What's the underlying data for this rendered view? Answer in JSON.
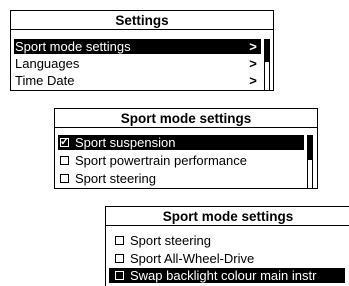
{
  "panel1": {
    "title": "Settings",
    "items": [
      {
        "label": "Sport mode settings",
        "chevron": ">",
        "selected": true
      },
      {
        "label": "Languages",
        "chevron": ">",
        "selected": false
      },
      {
        "label": "Time Date",
        "chevron": ">",
        "selected": false
      }
    ]
  },
  "panel2": {
    "title": "Sport mode settings",
    "items": [
      {
        "label": "Sport suspension",
        "checked": true,
        "selected": true
      },
      {
        "label": "Sport powertrain performance",
        "checked": false,
        "selected": false
      },
      {
        "label": "Sport steering",
        "checked": false,
        "selected": false
      }
    ]
  },
  "panel3": {
    "title": "Sport mode settings",
    "items": [
      {
        "label": "Sport steering",
        "checked": false,
        "selected": false
      },
      {
        "label": "Sport All-Wheel-Drive",
        "checked": false,
        "selected": false
      },
      {
        "label": "Swap backlight colour main instr",
        "checked": false,
        "selected": true
      }
    ]
  },
  "icons": {
    "checkmark": "check-icon",
    "chevron": "chevron-right-icon"
  },
  "colors": {
    "background": "#ffffff",
    "foreground": "#000000",
    "highlight": "#000000",
    "highlight_text": "#ffffff"
  }
}
